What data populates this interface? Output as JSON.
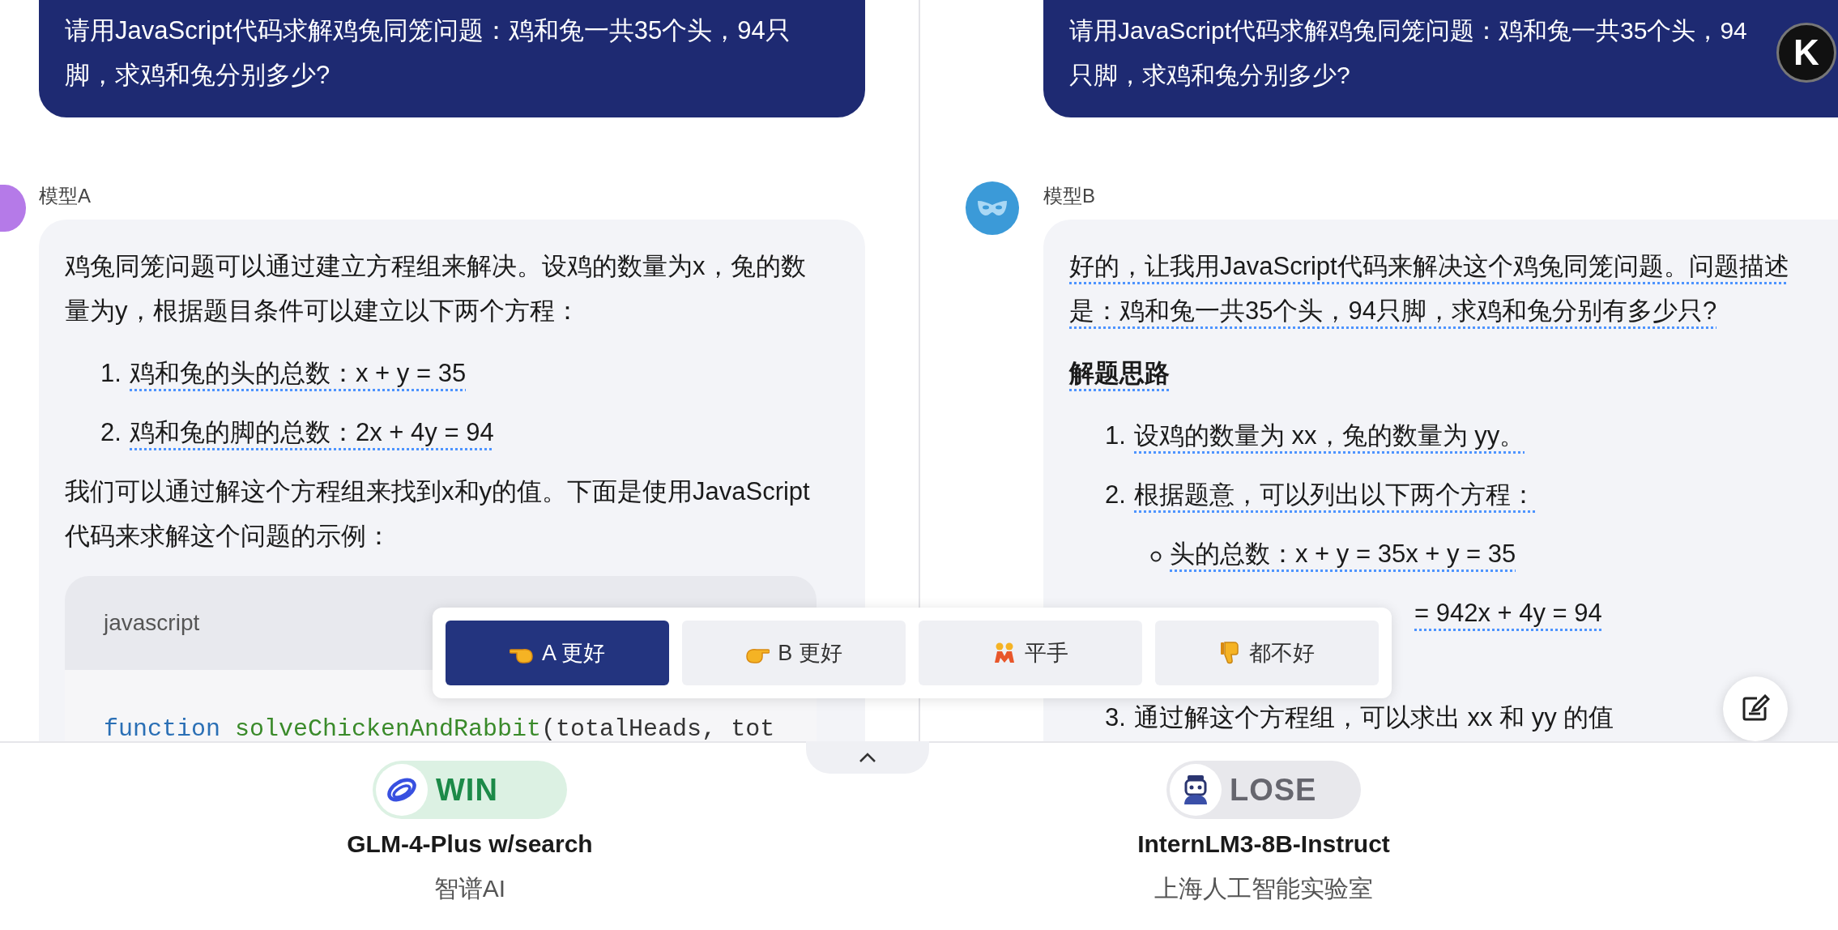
{
  "left": {
    "prompt": "请用JavaScript代码求解鸡兔同笼问题：鸡和兔一共35个头，94只脚，求鸡和兔分别多少?",
    "model_label": "模型A",
    "blocks": [
      {
        "kind": "paragraph",
        "text": "鸡兔同笼问题可以通过建立方程组来解决。设鸡的数量为x，兔的数量为y，根据题目条件可以建立以下两个方程：",
        "underlined": false
      },
      {
        "kind": "ordered",
        "number": "1.",
        "text": "鸡和兔的头的总数：x + y = 35",
        "underlined": true
      },
      {
        "kind": "ordered",
        "number": "2.",
        "text": "鸡和兔的脚的总数：2x + 4y = 94",
        "underlined": true
      },
      {
        "kind": "paragraph",
        "text": "我们可以通过解这个方程组来找到x和y的值。下面是使用JavaScript代码来求解这个问题的示例：",
        "underlined": false
      },
      {
        "kind": "code",
        "language": "javascript",
        "tokens": [
          {
            "text": "function ",
            "kind": "keyword"
          },
          {
            "text": "solveChickenAndRabbit",
            "kind": "name"
          },
          {
            "text": "(totalHeads, tot",
            "kind": "plain"
          }
        ]
      }
    ]
  },
  "right": {
    "prompt": "请用JavaScript代码求解鸡兔同笼问题：鸡和兔一共35个头，94只脚，求鸡和兔分别多少?",
    "model_label": "模型B",
    "badge": "K",
    "blocks": [
      {
        "kind": "paragraph",
        "text": "好的，让我用JavaScript代码来解决这个鸡兔同笼问题。问题描述是：鸡和兔一共35个头，94只脚，求鸡和兔分别有多少只?",
        "underlined": true
      },
      {
        "kind": "heading",
        "text": "解题思路",
        "underlined": true
      },
      {
        "kind": "ordered",
        "number": "1.",
        "text": "设鸡的数量为 xx，兔的数量为 yy。",
        "underlined": true
      },
      {
        "kind": "ordered",
        "number": "2.",
        "text": "根据题意，可以列出以下两个方程：",
        "underlined": true
      },
      {
        "kind": "bullet",
        "text": "头的总数：x + y = 35x + y = 35",
        "underlined": true
      },
      {
        "kind": "partial",
        "text": "= 942x + 4y = 94",
        "underlined": true
      },
      {
        "kind": "ordered",
        "number": "3.",
        "text": "通过解这个方程组，可以求出 xx 和 yy 的值",
        "underlined": false
      }
    ]
  },
  "vote": [
    {
      "label": "A 更好",
      "selected": true
    },
    {
      "label": "B 更好",
      "selected": false
    },
    {
      "label": "平手",
      "selected": false
    },
    {
      "label": "都不好",
      "selected": false
    }
  ],
  "results": [
    {
      "result": "WIN",
      "kind": "win",
      "model": "GLM-4-Plus w/search",
      "org": "智谱AI"
    },
    {
      "result": "LOSE",
      "kind": "lose",
      "model": "InternLM3-8B-Instruct",
      "org": "上海人工智能实验室"
    }
  ]
}
